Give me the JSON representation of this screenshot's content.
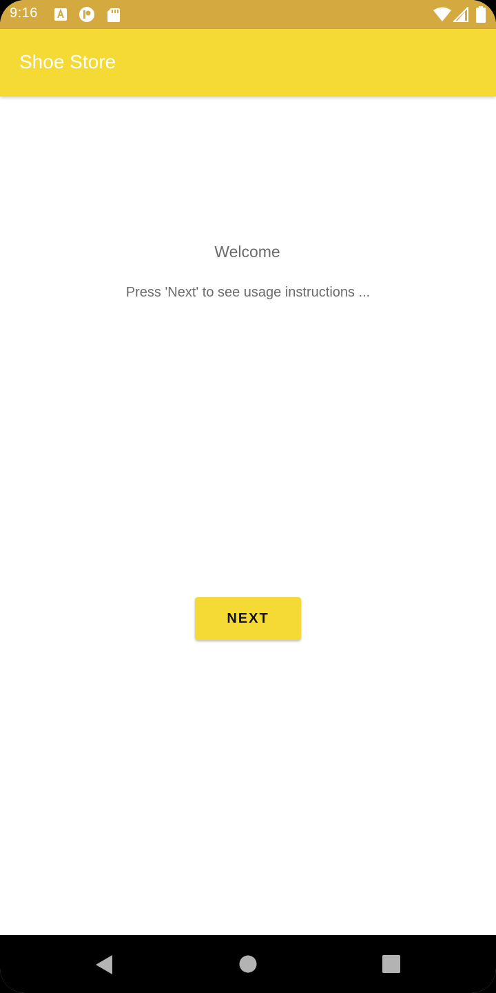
{
  "status_bar": {
    "time": "9:16",
    "background_color": "#D4A940",
    "notification_icons": [
      "text-a-icon",
      "ring-app-icon",
      "sd-card-icon"
    ],
    "system_icons": [
      "wifi-icon",
      "cell-signal-icon",
      "battery-icon"
    ]
  },
  "app_bar": {
    "title": "Shoe Store",
    "background_color": "#F5DA36"
  },
  "welcome_screen": {
    "heading": "Welcome",
    "instructions": "Press 'Next' to see usage instructions ...",
    "next_button_label": "NEXT"
  },
  "nav_bar": {
    "buttons": [
      "back-icon",
      "home-icon",
      "recents-icon"
    ]
  }
}
